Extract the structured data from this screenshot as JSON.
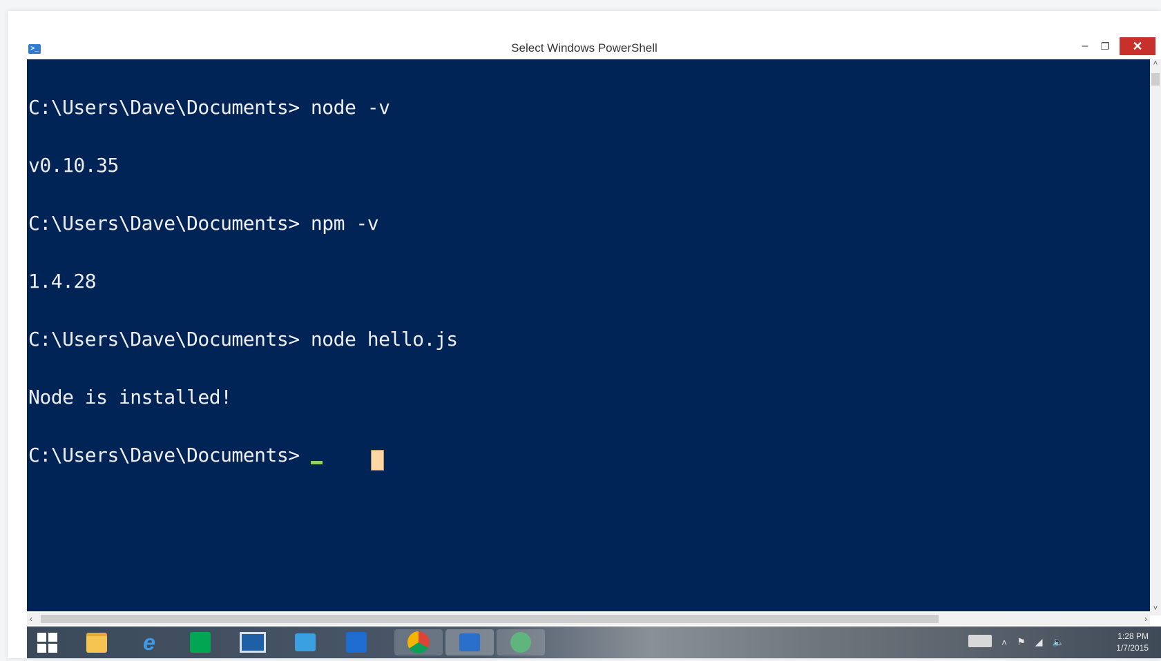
{
  "window": {
    "title": "Select Windows PowerShell",
    "app_icon": "powershell-icon",
    "controls": {
      "minimize": "–",
      "restore": "❐",
      "close": "✕"
    }
  },
  "console": {
    "background": "#012456",
    "foreground": "#eeedf0",
    "lines": [
      "C:\\Users\\Dave\\Documents> node -v",
      "v0.10.35",
      "C:\\Users\\Dave\\Documents> npm -v",
      "1.4.28",
      "C:\\Users\\Dave\\Documents> node hello.js",
      "Node is installed!",
      "C:\\Users\\Dave\\Documents> "
    ]
  },
  "scrollbars": {
    "up": "˄",
    "down": "˅",
    "left": "‹",
    "right": "›"
  },
  "taskbar": {
    "icons": [
      "windows-start-icon",
      "file-explorer-icon",
      "internet-explorer-icon",
      "store-icon",
      "remote-desktop-icon",
      "mail-icon",
      "remote-app-icon",
      "chrome-icon",
      "powershell-icon",
      "atom-icon"
    ],
    "tray": {
      "show_hidden": "˄",
      "flag": "⚑",
      "network": "◢",
      "volume": "🔈"
    },
    "clock": {
      "time": "1:28 PM",
      "date": "1/7/2015"
    }
  }
}
